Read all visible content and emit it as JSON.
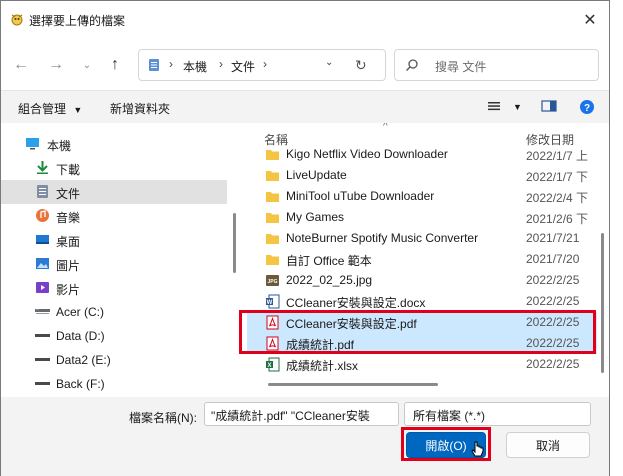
{
  "window": {
    "title": "選擇要上傳的檔案"
  },
  "address": {
    "crumbs": [
      "本機",
      "文件"
    ]
  },
  "search": {
    "placeholder": "搜尋 文件"
  },
  "toolbar": {
    "organize": "組合管理",
    "new_folder": "新增資料夾"
  },
  "nav_pane": {
    "items": [
      {
        "label": "本機",
        "icon": "computer-icon"
      },
      {
        "label": "下載",
        "icon": "download-icon"
      },
      {
        "label": "文件",
        "icon": "document-icon",
        "selected": true
      },
      {
        "label": "音樂",
        "icon": "music-icon"
      },
      {
        "label": "桌面",
        "icon": "desktop-icon"
      },
      {
        "label": "圖片",
        "icon": "pictures-icon"
      },
      {
        "label": "影片",
        "icon": "videos-icon"
      },
      {
        "label": "Acer (C:)",
        "icon": "drive-icon"
      },
      {
        "label": "Data (D:)",
        "icon": "drive-icon"
      },
      {
        "label": "Data2 (E:)",
        "icon": "drive-icon"
      },
      {
        "label": "Back (F:)",
        "icon": "drive-icon"
      }
    ]
  },
  "file_list": {
    "col_name": "名稱",
    "col_date": "修改日期",
    "rows": [
      {
        "name": "Kigo Netflix Video Downloader",
        "date": "2022/1/7 上",
        "icon": "folder-icon"
      },
      {
        "name": "LiveUpdate",
        "date": "2022/1/7 下",
        "icon": "folder-icon"
      },
      {
        "name": "MiniTool uTube Downloader",
        "date": "2022/2/4 下",
        "icon": "folder-icon"
      },
      {
        "name": "My Games",
        "date": "2021/2/6 下",
        "icon": "folder-icon"
      },
      {
        "name": "NoteBurner Spotify Music Converter",
        "date": "2021/7/21 ",
        "icon": "folder-icon"
      },
      {
        "name": "自訂 Office 範本",
        "date": "2021/7/20 ",
        "icon": "folder-icon"
      },
      {
        "name": "2022_02_25.jpg",
        "date": "2022/2/25 ",
        "icon": "jpg-icon"
      },
      {
        "name": "CCleaner安裝與設定.docx",
        "date": "2022/2/25 ",
        "icon": "word-icon"
      },
      {
        "name": "CCleaner安裝與設定.pdf",
        "date": "2022/2/25 ",
        "icon": "pdf-icon",
        "selected": true
      },
      {
        "name": "成績統計.pdf",
        "date": "2022/2/25 ",
        "icon": "pdf-icon",
        "selected": true
      },
      {
        "name": "成績統計.xlsx",
        "date": "2022/2/25 ",
        "icon": "excel-icon"
      }
    ]
  },
  "bottom": {
    "filename_label": "檔案名稱(N):",
    "filename_value": "\"成績統計.pdf\" \"CCleaner安裝",
    "filter_value": "所有檔案 (*.*)",
    "open_label": "開啟(O)",
    "cancel_label": "取消"
  },
  "colors": {
    "accent": "#0067c0",
    "highlight": "#e0001a",
    "selection": "#cce8ff"
  }
}
